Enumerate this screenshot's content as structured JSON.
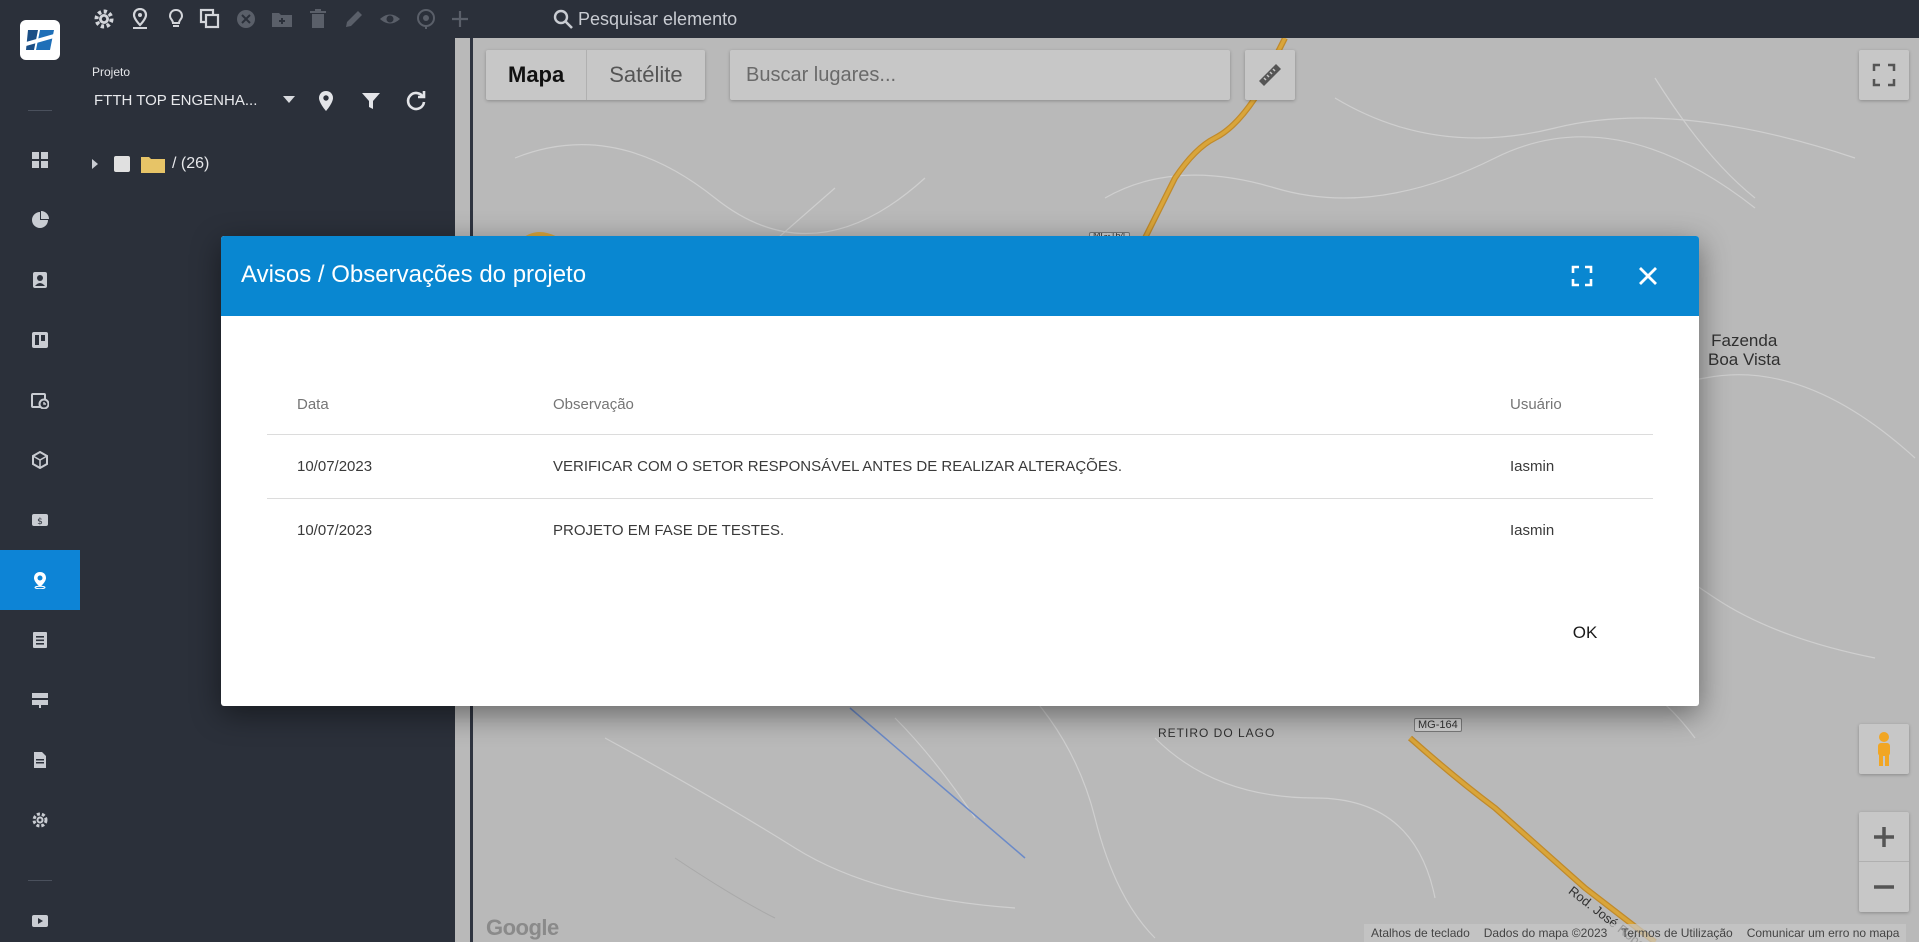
{
  "toolbar": {
    "search_placeholder": "Pesquisar elemento",
    "tools": [
      "gear-icon",
      "pin-route-icon",
      "bulb-icon",
      "copy-icon",
      "cancel-icon",
      "folder-add-icon",
      "trash-icon",
      "pencil-icon",
      "eye-icon",
      "location-icon",
      "plus-icon"
    ]
  },
  "sidebar": {
    "items": [
      "dashboard-icon",
      "pie-chart-icon",
      "contact-card-icon",
      "board-icon",
      "calendar-clock-icon",
      "cube-icon",
      "money-icon",
      "map-pin-icon",
      "list-icon",
      "server-icon",
      "document-icon",
      "settings-icon",
      "video-icon"
    ],
    "active": "map-pin-icon"
  },
  "panel": {
    "label": "Projeto",
    "project_name": "FTTH TOP ENGENHA...",
    "tree_root": "/ (26)"
  },
  "map": {
    "type_buttons": [
      "Mapa",
      "Satélite"
    ],
    "selected_type": "Mapa",
    "places_placeholder": "Buscar lugares...",
    "labels": {
      "farm": "Fazenda\nBoa Vista",
      "district": "RETIRO DO LAGO",
      "highway_badge": "MG-164",
      "highway_badge_top": "MG-164",
      "road": "Rod. José Roberto P..."
    },
    "google_logo": "Google",
    "attribution": [
      "Atalhos de teclado",
      "Dados do mapa ©2023",
      "Termos de Utilização",
      "Comunicar um erro no mapa"
    ]
  },
  "dialog": {
    "title": "Avisos / Observações do projeto",
    "columns": [
      "Data",
      "Observação",
      "Usuário"
    ],
    "rows": [
      {
        "data": "10/07/2023",
        "observacao": "VERIFICAR COM O SETOR RESPONSÁVEL ANTES DE REALIZAR ALTERAÇÕES.",
        "usuario": "Iasmin"
      },
      {
        "data": "10/07/2023",
        "observacao": "PROJETO EM FASE DE TESTES.",
        "usuario": "Iasmin"
      }
    ],
    "ok_label": "OK"
  },
  "colors": {
    "dialog_header": "#0987d1",
    "sidebar_bg": "#2b303a",
    "active_item": "#0d84d6",
    "highway": "#d9a53a"
  }
}
